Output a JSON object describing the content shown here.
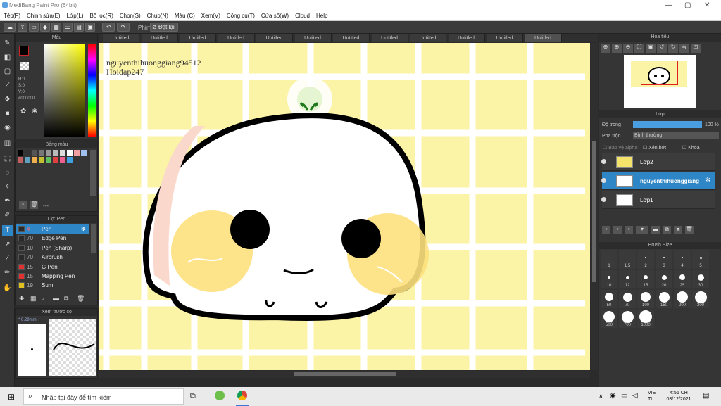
{
  "app": {
    "title": "MediBang Paint Pro (64bit)"
  },
  "menu": [
    "Tệp(F)",
    "Chỉnh sửa(E)",
    "Lớp(L)",
    "Bộ lọc(R)",
    "Chọn(S)",
    "Chụp(N)",
    "Màu (C)",
    "Xem(V)",
    "Công cụ(T)",
    "Cửa sổ(W)",
    "Cloud",
    "Help"
  ],
  "toolbar": {
    "key_label": "Phím",
    "reset_label": "Đặt lại"
  },
  "color_panel": {
    "title": "Màu",
    "h": "H:0",
    "s": "S:0",
    "v": "V:0",
    "hex": "#000000"
  },
  "palette_panel": {
    "title": "Bảng màu",
    "dashes": "---"
  },
  "brush_panel": {
    "title": "Cọ: Pen",
    "items": [
      {
        "size": "4",
        "name": "Pen",
        "color": "#2a2a2a"
      },
      {
        "size": "70",
        "name": "Edge Pen",
        "color": "#2a2a2a"
      },
      {
        "size": "10",
        "name": "Pen (Sharp)",
        "color": "#2a2a2a"
      },
      {
        "size": "70",
        "name": "Airbrush",
        "color": "#2a2a2a"
      },
      {
        "size": "15",
        "name": "G Pen",
        "color": "#e03030"
      },
      {
        "size": "15",
        "name": "Mapping Pen",
        "color": "#e03030"
      },
      {
        "size": "19",
        "name": "Sumi",
        "color": "#e0c020"
      }
    ]
  },
  "preview_panel": {
    "title": "Xem trước cọ",
    "size": "* 0.29mm"
  },
  "tabs": [
    "Untitled",
    "Untitled",
    "Untitled",
    "Untitled",
    "Untitled",
    "Untitled",
    "Untitled",
    "Untitled",
    "Untitled",
    "Untitled",
    "Untitled",
    "Untitled"
  ],
  "canvas": {
    "watermark1": "nguyenthihuonggiang94512",
    "watermark2": "Hoidap247"
  },
  "navigator": {
    "title": "Hoa tiêu"
  },
  "layer_panel": {
    "title": "Lớp",
    "opacity_label": "Độ trong",
    "opacity_value": "100 %",
    "blend_label": "Pha trộn",
    "blend_value": "Bình thường",
    "protect_alpha": "Bảo vệ alpha",
    "clip": "Xén bớt",
    "lock": "Khóa",
    "layers": [
      {
        "name": "Lớp2",
        "selected": false
      },
      {
        "name": "nguyenthihuonggiang",
        "selected": true
      },
      {
        "name": "Lớp1",
        "selected": false
      }
    ]
  },
  "brush_size": {
    "title": "Brush Size",
    "sizes": [
      "1",
      "1.5",
      "2",
      "3",
      "4",
      "5",
      "10",
      "12",
      "15",
      "20",
      "25",
      "30",
      "50",
      "70",
      "100",
      "150",
      "200",
      "300",
      "500",
      "700",
      "1000"
    ]
  },
  "taskbar": {
    "search": "Nhập tại đây để tìm kiếm",
    "lang1": "VIE",
    "lang2": "TL",
    "time": "4:56 CH",
    "date": "03/12/2021"
  }
}
